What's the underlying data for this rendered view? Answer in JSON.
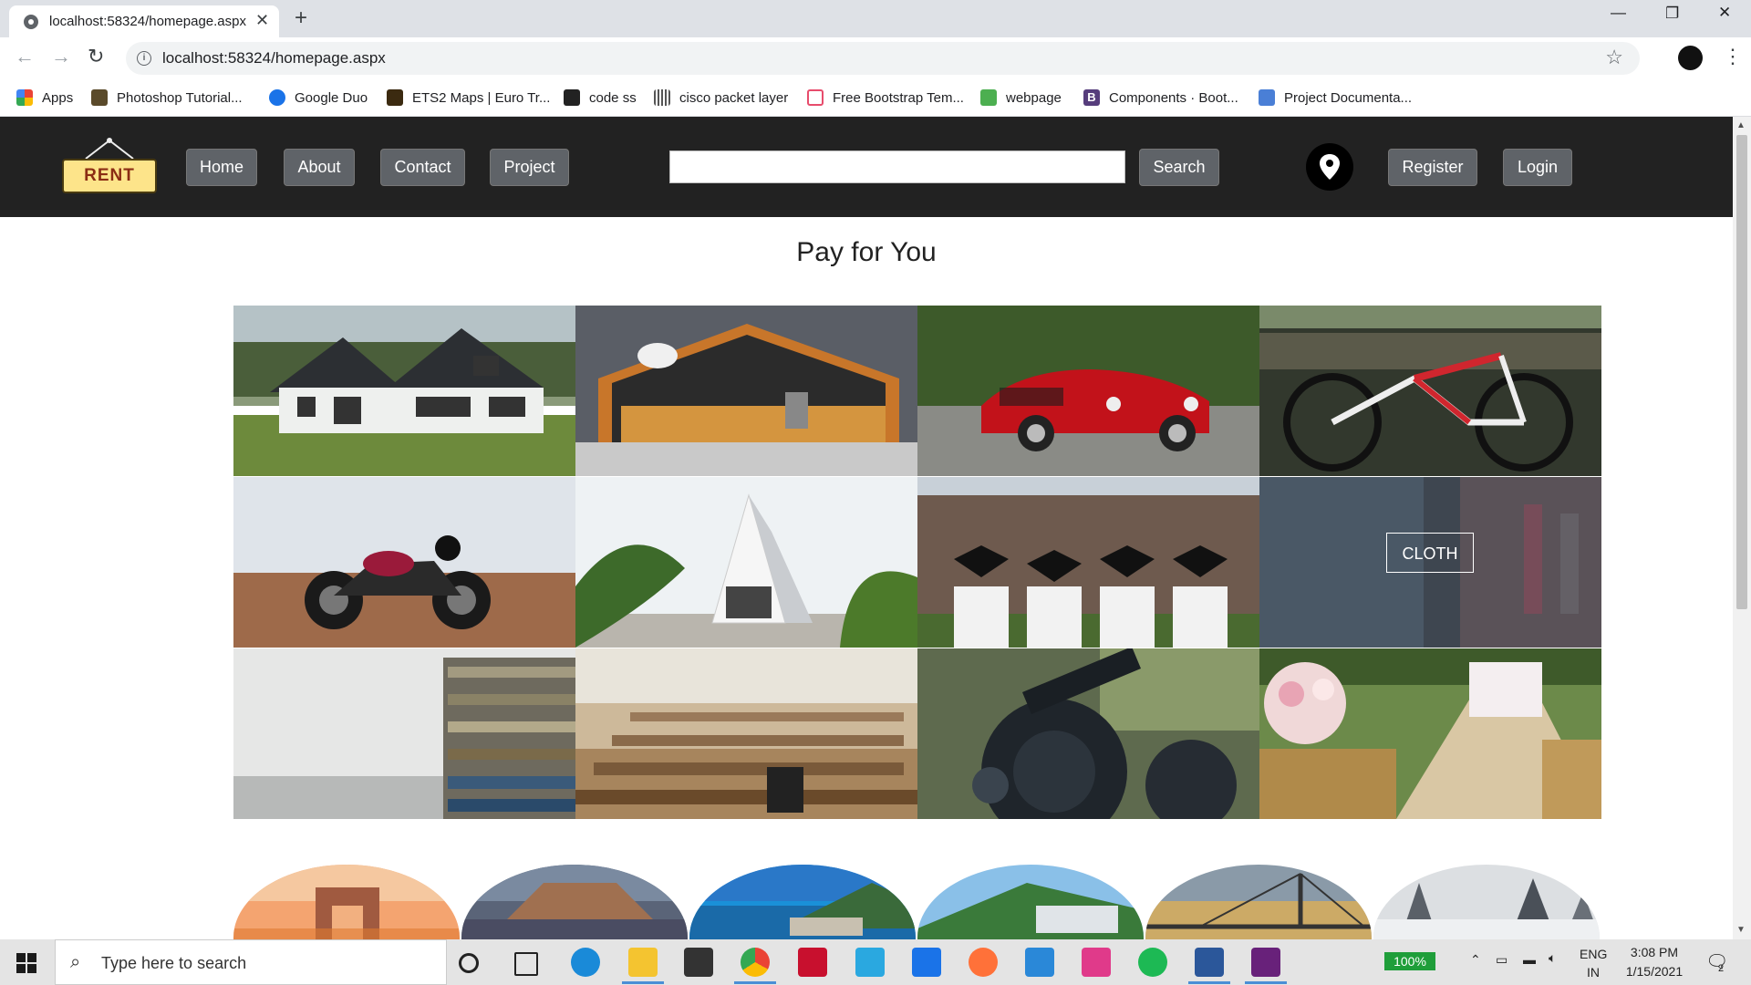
{
  "browser": {
    "tab_title": "localhost:58324/homepage.aspx",
    "url": "localhost:58324/homepage.aspx",
    "bookmarks": [
      "Apps",
      "Photoshop Tutorial...",
      "Google Duo",
      "ETS2 Maps | Euro Tr...",
      "code ss",
      "cisco packet layer",
      "Free Bootstrap Tem...",
      "webpage",
      "Components · Boot...",
      "Project Documenta..."
    ]
  },
  "site": {
    "logo_text": "RENT",
    "nav": [
      "Home",
      "About",
      "Contact",
      "Project"
    ],
    "search_button": "Search",
    "search_value": "",
    "register": "Register",
    "login": "Login",
    "title": "Pay for You",
    "tiles": [
      {
        "icon": "house-image"
      },
      {
        "icon": "shop-image"
      },
      {
        "icon": "red-car-image"
      },
      {
        "icon": "bicycle-image"
      },
      {
        "icon": "motorcycle-image"
      },
      {
        "icon": "building-image"
      },
      {
        "icon": "graduates-image"
      },
      {
        "icon": "cloth-image",
        "label": "CLOTH"
      },
      {
        "icon": "books-image"
      },
      {
        "icon": "lecture-hall-image"
      },
      {
        "icon": "machinery-image"
      },
      {
        "icon": "wedding-venue-image"
      }
    ],
    "cities": [
      "india-gate-image",
      "fort-image",
      "beach-image",
      "hillside-image",
      "sea-bridge-image",
      "snow-forest-image"
    ]
  },
  "taskbar": {
    "search_placeholder": "Type here to search",
    "battery": "100%",
    "language_1": "ENG",
    "language_2": "IN",
    "time": "3:08 PM",
    "date": "1/15/2021",
    "notifications": "2"
  }
}
